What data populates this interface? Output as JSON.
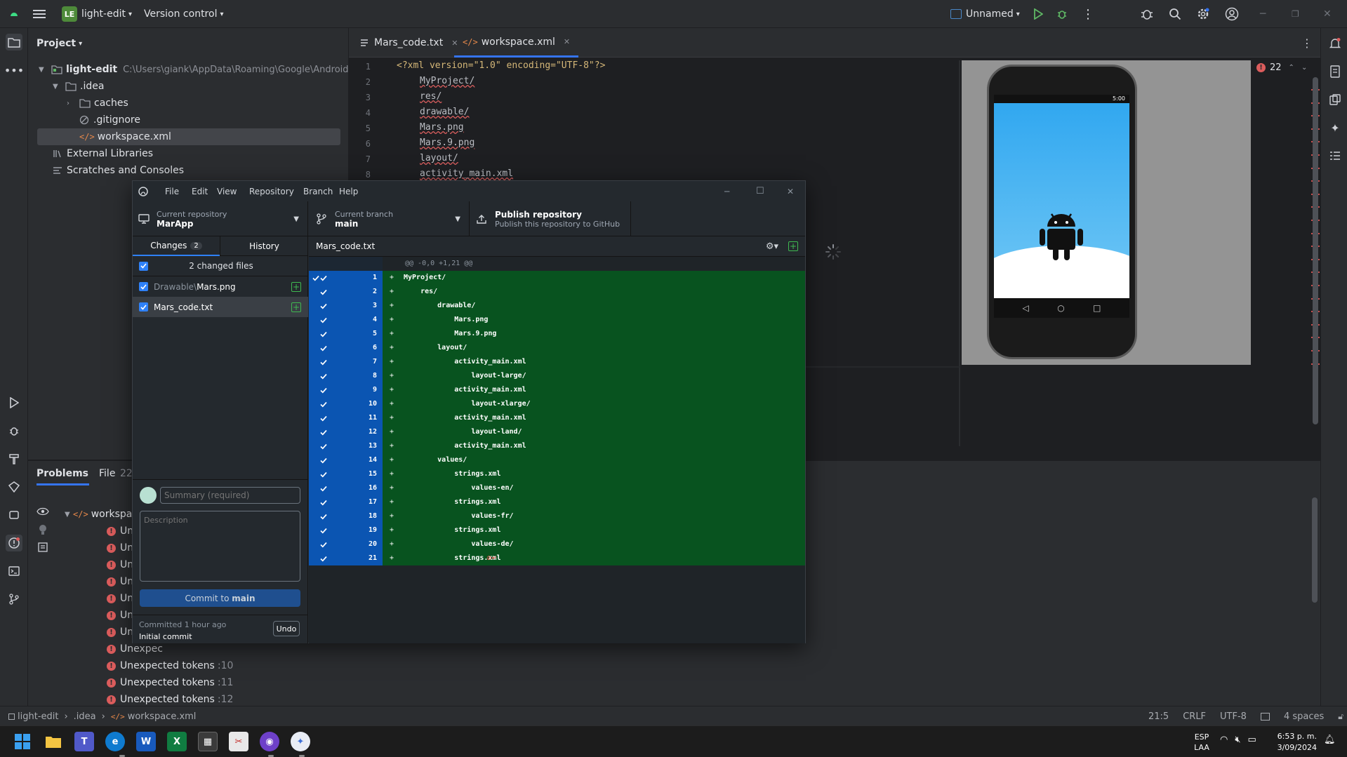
{
  "ide": {
    "project_badge": "LE",
    "project_name": "light-edit",
    "vcs_menu": "Version control",
    "run_config": "Unnamed"
  },
  "project_panel": {
    "title": "Project",
    "root": {
      "name": "light-edit",
      "path": "C:\\Users\\giank\\AppData\\Roaming\\Google\\AndroidStuc"
    },
    "items": [
      ".idea",
      "caches",
      ".gitignore",
      "workspace.xml"
    ],
    "external_libraries": "External Libraries",
    "scratches": "Scratches and Consoles"
  },
  "editor": {
    "tabs": [
      {
        "label": "Mars_code.txt",
        "active": false
      },
      {
        "label": "workspace.xml",
        "active": true
      }
    ],
    "error_count": "22",
    "line_numbers": [
      "1",
      "2",
      "3",
      "4",
      "5",
      "6",
      "7",
      "8"
    ],
    "lines": [
      "<?xml version=\"1.0\" encoding=\"UTF-8\"?>",
      "MyProject/",
      "res/",
      "drawable/",
      "Mars.png",
      "Mars.9.png",
      "layout/",
      "activity_main.xml"
    ]
  },
  "phone_preview": {
    "status_time": "5:00"
  },
  "bottom_panel": {
    "tabs": [
      "Problems",
      "File",
      "22"
    ],
    "file_label": "workspace.x",
    "problems": [
      {
        "text": "Unexpec",
        "line": ""
      },
      {
        "text": "Unexpec",
        "line": ""
      },
      {
        "text": "Unexpec",
        "line": ""
      },
      {
        "text": "Unexpec",
        "line": ""
      },
      {
        "text": "Unexpec",
        "line": ""
      },
      {
        "text": "Unexpec",
        "line": ""
      },
      {
        "text": "Unexpec",
        "line": ""
      },
      {
        "text": "Unexpec",
        "line": ""
      },
      {
        "text": "Unexpected tokens",
        "line": ":10"
      },
      {
        "text": "Unexpected tokens",
        "line": ":11"
      },
      {
        "text": "Unexpected tokens",
        "line": ":12"
      }
    ]
  },
  "statusbar": {
    "breadcrumb": [
      "light-edit",
      ".idea",
      "workspace.xml"
    ],
    "position": "21:5",
    "line_sep": "CRLF",
    "encoding": "UTF-8",
    "indent": "4 spaces"
  },
  "github": {
    "menu": [
      "File",
      "Edit",
      "View",
      "Repository",
      "Branch",
      "Help"
    ],
    "current_repository_label": "Current repository",
    "current_repository": "MarApp",
    "current_branch_label": "Current branch",
    "current_branch": "main",
    "publish_title": "Publish repository",
    "publish_sub": "Publish this repository to GitHub",
    "tab_changes": "Changes",
    "changes_count": "2",
    "tab_history": "History",
    "changed_files_header": "2 changed files",
    "files": [
      {
        "dir": "Drawable\\",
        "name": "Mars.png"
      },
      {
        "dir": "",
        "name": "Mars_code.txt"
      }
    ],
    "diff_file": "Mars_code.txt",
    "hunk_header": "@@ -0,0 +1,21 @@",
    "diff_lines": [
      {
        "n": "1",
        "t": "MyProject/"
      },
      {
        "n": "2",
        "t": "    res/"
      },
      {
        "n": "3",
        "t": "        drawable/"
      },
      {
        "n": "4",
        "t": "            Mars.png"
      },
      {
        "n": "5",
        "t": "            Mars.9.png"
      },
      {
        "n": "6",
        "t": "        layout/"
      },
      {
        "n": "7",
        "t": "            activity_main.xml"
      },
      {
        "n": "8",
        "t": "                layout-large/"
      },
      {
        "n": "9",
        "t": "            activity_main.xml"
      },
      {
        "n": "10",
        "t": "                layout-xlarge/"
      },
      {
        "n": "11",
        "t": "            activity_main.xml"
      },
      {
        "n": "12",
        "t": "                layout-land/"
      },
      {
        "n": "13",
        "t": "            activity_main.xml"
      },
      {
        "n": "14",
        "t": "        values/"
      },
      {
        "n": "15",
        "t": "            strings.xml"
      },
      {
        "n": "16",
        "t": "                values-en/"
      },
      {
        "n": "17",
        "t": "            strings.xml"
      },
      {
        "n": "18",
        "t": "                values-fr/"
      },
      {
        "n": "19",
        "t": "            strings.xml"
      },
      {
        "n": "20",
        "t": "                values-de/"
      },
      {
        "n": "21",
        "t": "            strings.xml"
      }
    ],
    "summary_placeholder": "Summary (required)",
    "description_placeholder": "Description",
    "commit_prefix": "Commit to ",
    "commit_branch": "main",
    "last_commit_time": "Committed 1 hour ago",
    "last_commit_msg": "Initial commit",
    "undo": "Undo"
  },
  "taskbar": {
    "lang": "ESP",
    "layout": "LAA",
    "time": "6:53 p. m.",
    "date": "3/09/2024"
  },
  "colors": {
    "diff_added": "#08531f",
    "line_num_bg": "#0b55b2",
    "error": "#db5c5c",
    "accent": "#2f81f7"
  }
}
